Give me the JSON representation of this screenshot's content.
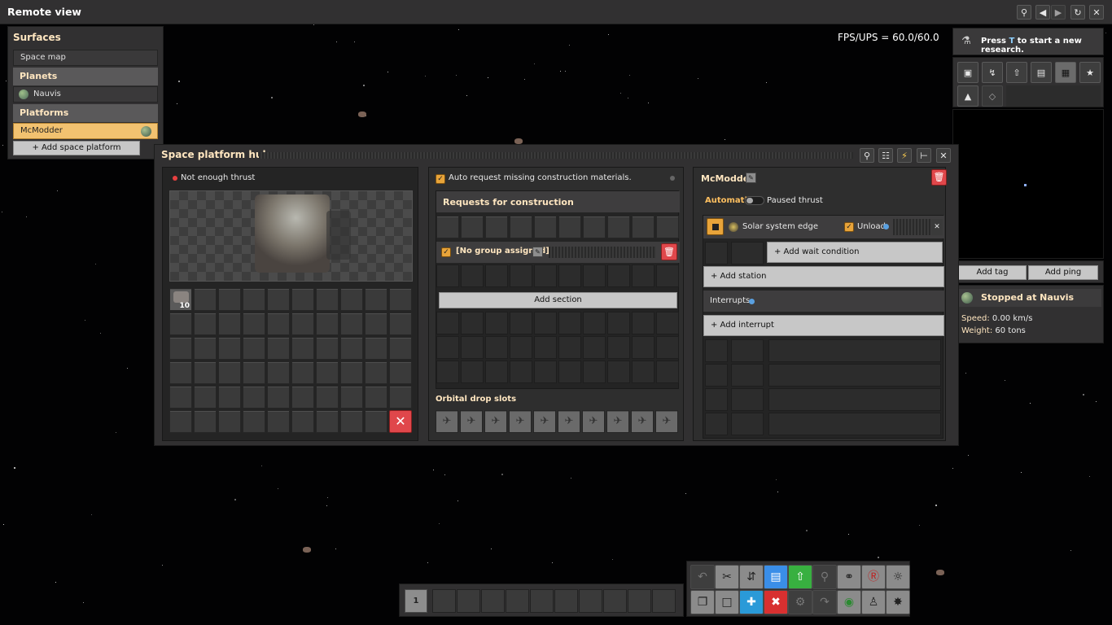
{
  "window": {
    "title": "Remote view"
  },
  "stats": {
    "fps": "FPS/UPS = 60.0/60.0"
  },
  "surfaces": {
    "title": "Surfaces",
    "space_map": "Space map",
    "planets_header": "Planets",
    "planets": [
      "Nauvis"
    ],
    "platforms_header": "Platforms",
    "platforms": [
      "McModder"
    ],
    "add_platform": "+ Add space platform"
  },
  "research": {
    "pre": "Press ",
    "key": "T",
    "post": " to start a new research."
  },
  "map_buttons": {
    "add_tag": "Add tag",
    "add_ping": "Add ping"
  },
  "status": {
    "title": "Stopped at Nauvis",
    "speed_label": "Speed:",
    "speed": "0.00 km/s",
    "weight_label": "Weight:",
    "weight": "60 tons"
  },
  "hub": {
    "title": "Space platform hub",
    "thrust_status": "Not enough thrust",
    "inventory_count": "10",
    "auto_request": "Auto request missing construction materials.",
    "requests_title": "Requests for construction",
    "no_group": "[No group assigned]",
    "add_section": "Add section",
    "orbital_drop": "Orbital drop slots"
  },
  "schedule": {
    "name": "McModder",
    "automatic": "Automatic",
    "paused": "Paused thrust",
    "station": "Solar system edge",
    "unload": "Unload",
    "add_wait": "+ Add wait condition",
    "add_station": "+ Add station",
    "interrupts": "Interrupts",
    "add_interrupt": "+ Add interrupt"
  },
  "hotbar": {
    "page": "1"
  },
  "colors": {
    "accent": "#e8a43a",
    "danger": "#e0474b",
    "title_text": "#ffe6c0",
    "panel": "#313031"
  }
}
